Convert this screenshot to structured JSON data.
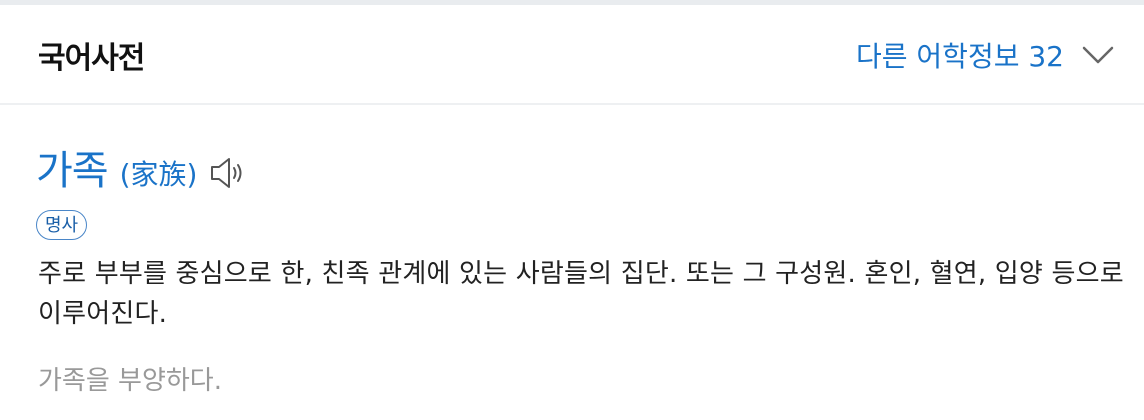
{
  "header": {
    "title": "국어사전",
    "more_label": "다른 어학정보 32",
    "more_icon": "chevron-down-icon",
    "accent_color": "#1a73c8"
  },
  "entry": {
    "word": "가족",
    "hanja": "(家族)",
    "speaker_icon": "speaker-icon",
    "part_of_speech": "명사",
    "definition": "주로 부부를 중심으로 한, 친족 관계에 있는 사람들의 집단. 또는 그 구성원. 혼인, 혈연, 입양 등으로 이루어진다.",
    "example": "가족을 부양하다."
  }
}
